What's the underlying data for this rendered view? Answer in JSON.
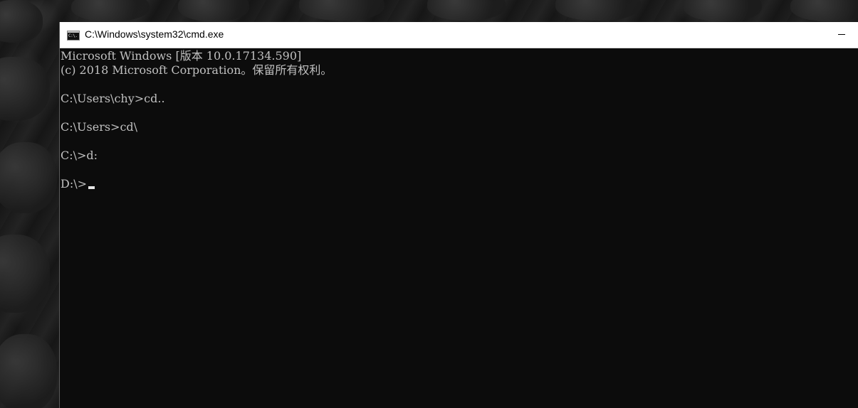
{
  "window": {
    "title": "C:\\Windows\\system32\\cmd.exe",
    "icon": "cmd-app-icon",
    "icon_text": "C:\\."
  },
  "console": {
    "lines": [
      "Microsoft Windows [版本 10.0.17134.590]",
      "(c) 2018 Microsoft Corporation。保留所有权利。",
      "",
      "C:\\Users\\chy>cd..",
      "",
      "C:\\Users>cd\\",
      "",
      "C:\\>d:",
      ""
    ],
    "current_prompt": "D:\\>",
    "text_color": "#c0c0c0",
    "background_color": "#0c0c0c"
  }
}
